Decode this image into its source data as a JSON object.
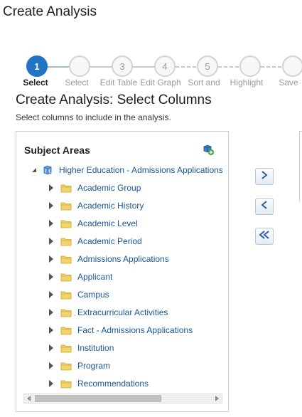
{
  "page_title": "Create Analysis",
  "train": {
    "steps": [
      {
        "number": "1",
        "label": "Select",
        "active": true
      },
      {
        "number": "",
        "label": "Select",
        "active": false
      },
      {
        "number": "3",
        "label": "Edit Table",
        "active": false
      },
      {
        "number": "4",
        "label": "Edit Graph",
        "active": false
      },
      {
        "number": "5",
        "label": "Sort and",
        "active": false
      },
      {
        "number": "",
        "label": "Highlight",
        "active": false
      },
      {
        "number": "",
        "label": "Save",
        "active": false
      }
    ]
  },
  "section": {
    "title": "Create Analysis: Select Columns",
    "subtitle": "Select columns to include in the analysis."
  },
  "subject_areas": {
    "header": "Subject Areas",
    "root": {
      "label": "Higher Education - Admissions Applications",
      "expanded": true
    },
    "folders": [
      "Academic Group",
      "Academic History",
      "Academic Level",
      "Academic Period",
      "Admissions Applications",
      "Applicant",
      "Campus",
      "Extracurricular Activities",
      "Fact - Admissions Applications",
      "Institution",
      "Program",
      "Recommendations"
    ]
  },
  "icons": {
    "add_subject_area": "add-subject-area-icon",
    "expand": "triangle-right-icon",
    "collapse": "triangle-down-icon",
    "folder": "folder-icon",
    "subject_area": "cube-icon",
    "move_right": "chevron-right-icon",
    "move_left": "chevron-left-icon",
    "move_all_left": "double-chevron-left-icon"
  },
  "colors": {
    "accent": "#1f74c4",
    "link": "#19569a",
    "folder": "#f3d46a"
  }
}
